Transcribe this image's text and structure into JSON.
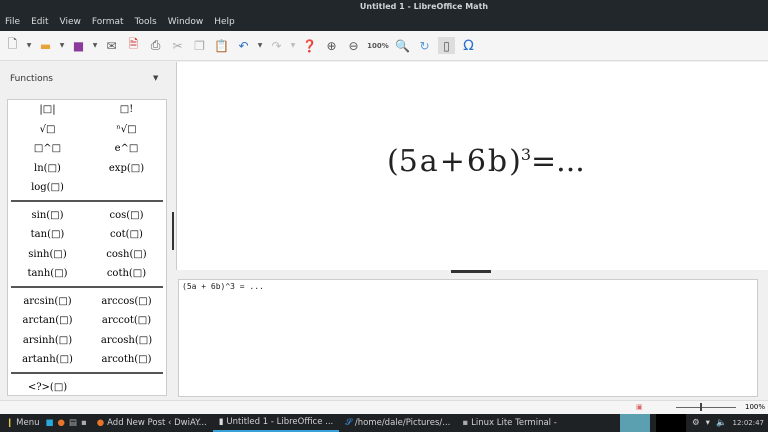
{
  "window_title": "Untitled 1 - LibreOffice Math",
  "menu": [
    "File",
    "Edit",
    "View",
    "Format",
    "Tools",
    "Window",
    "Help"
  ],
  "toolbar": {
    "zoom_label": "100%"
  },
  "sidebar": {
    "title": "Functions",
    "groups": [
      [
        [
          "|□|",
          "□!"
        ],
        [
          "√□",
          "ⁿ√□"
        ],
        [
          "□^□",
          "e^□"
        ],
        [
          "ln(□)",
          "exp(□)"
        ],
        [
          "log(□)",
          ""
        ]
      ],
      [
        [
          "sin(□)",
          "cos(□)"
        ],
        [
          "tan(□)",
          "cot(□)"
        ],
        [
          "sinh(□)",
          "cosh(□)"
        ],
        [
          "tanh(□)",
          "coth(□)"
        ]
      ],
      [
        [
          "arcsin(□)",
          "arccos(□)"
        ],
        [
          "arctan(□)",
          "arccot(□)"
        ],
        [
          "arsinh(□)",
          "arcosh(□)"
        ],
        [
          "artanh(□)",
          "arcoth(□)"
        ]
      ],
      [
        [
          "<?>(□)",
          ""
        ]
      ]
    ]
  },
  "formula": {
    "base": "5a+6b",
    "exponent": "3",
    "rhs": "=..."
  },
  "command": {
    "text": "(5a + 6b)^3 = ..."
  },
  "status": {
    "zoom": "100%"
  },
  "taskbar": {
    "menu": "Menu",
    "tasks": [
      "Add New Post ‹ DwiAY...",
      "Untitled 1 - LibreOffice ...",
      "/home/dale/Pictures/...",
      "Linux Lite Terminal -"
    ],
    "clock": "12:02:47"
  }
}
